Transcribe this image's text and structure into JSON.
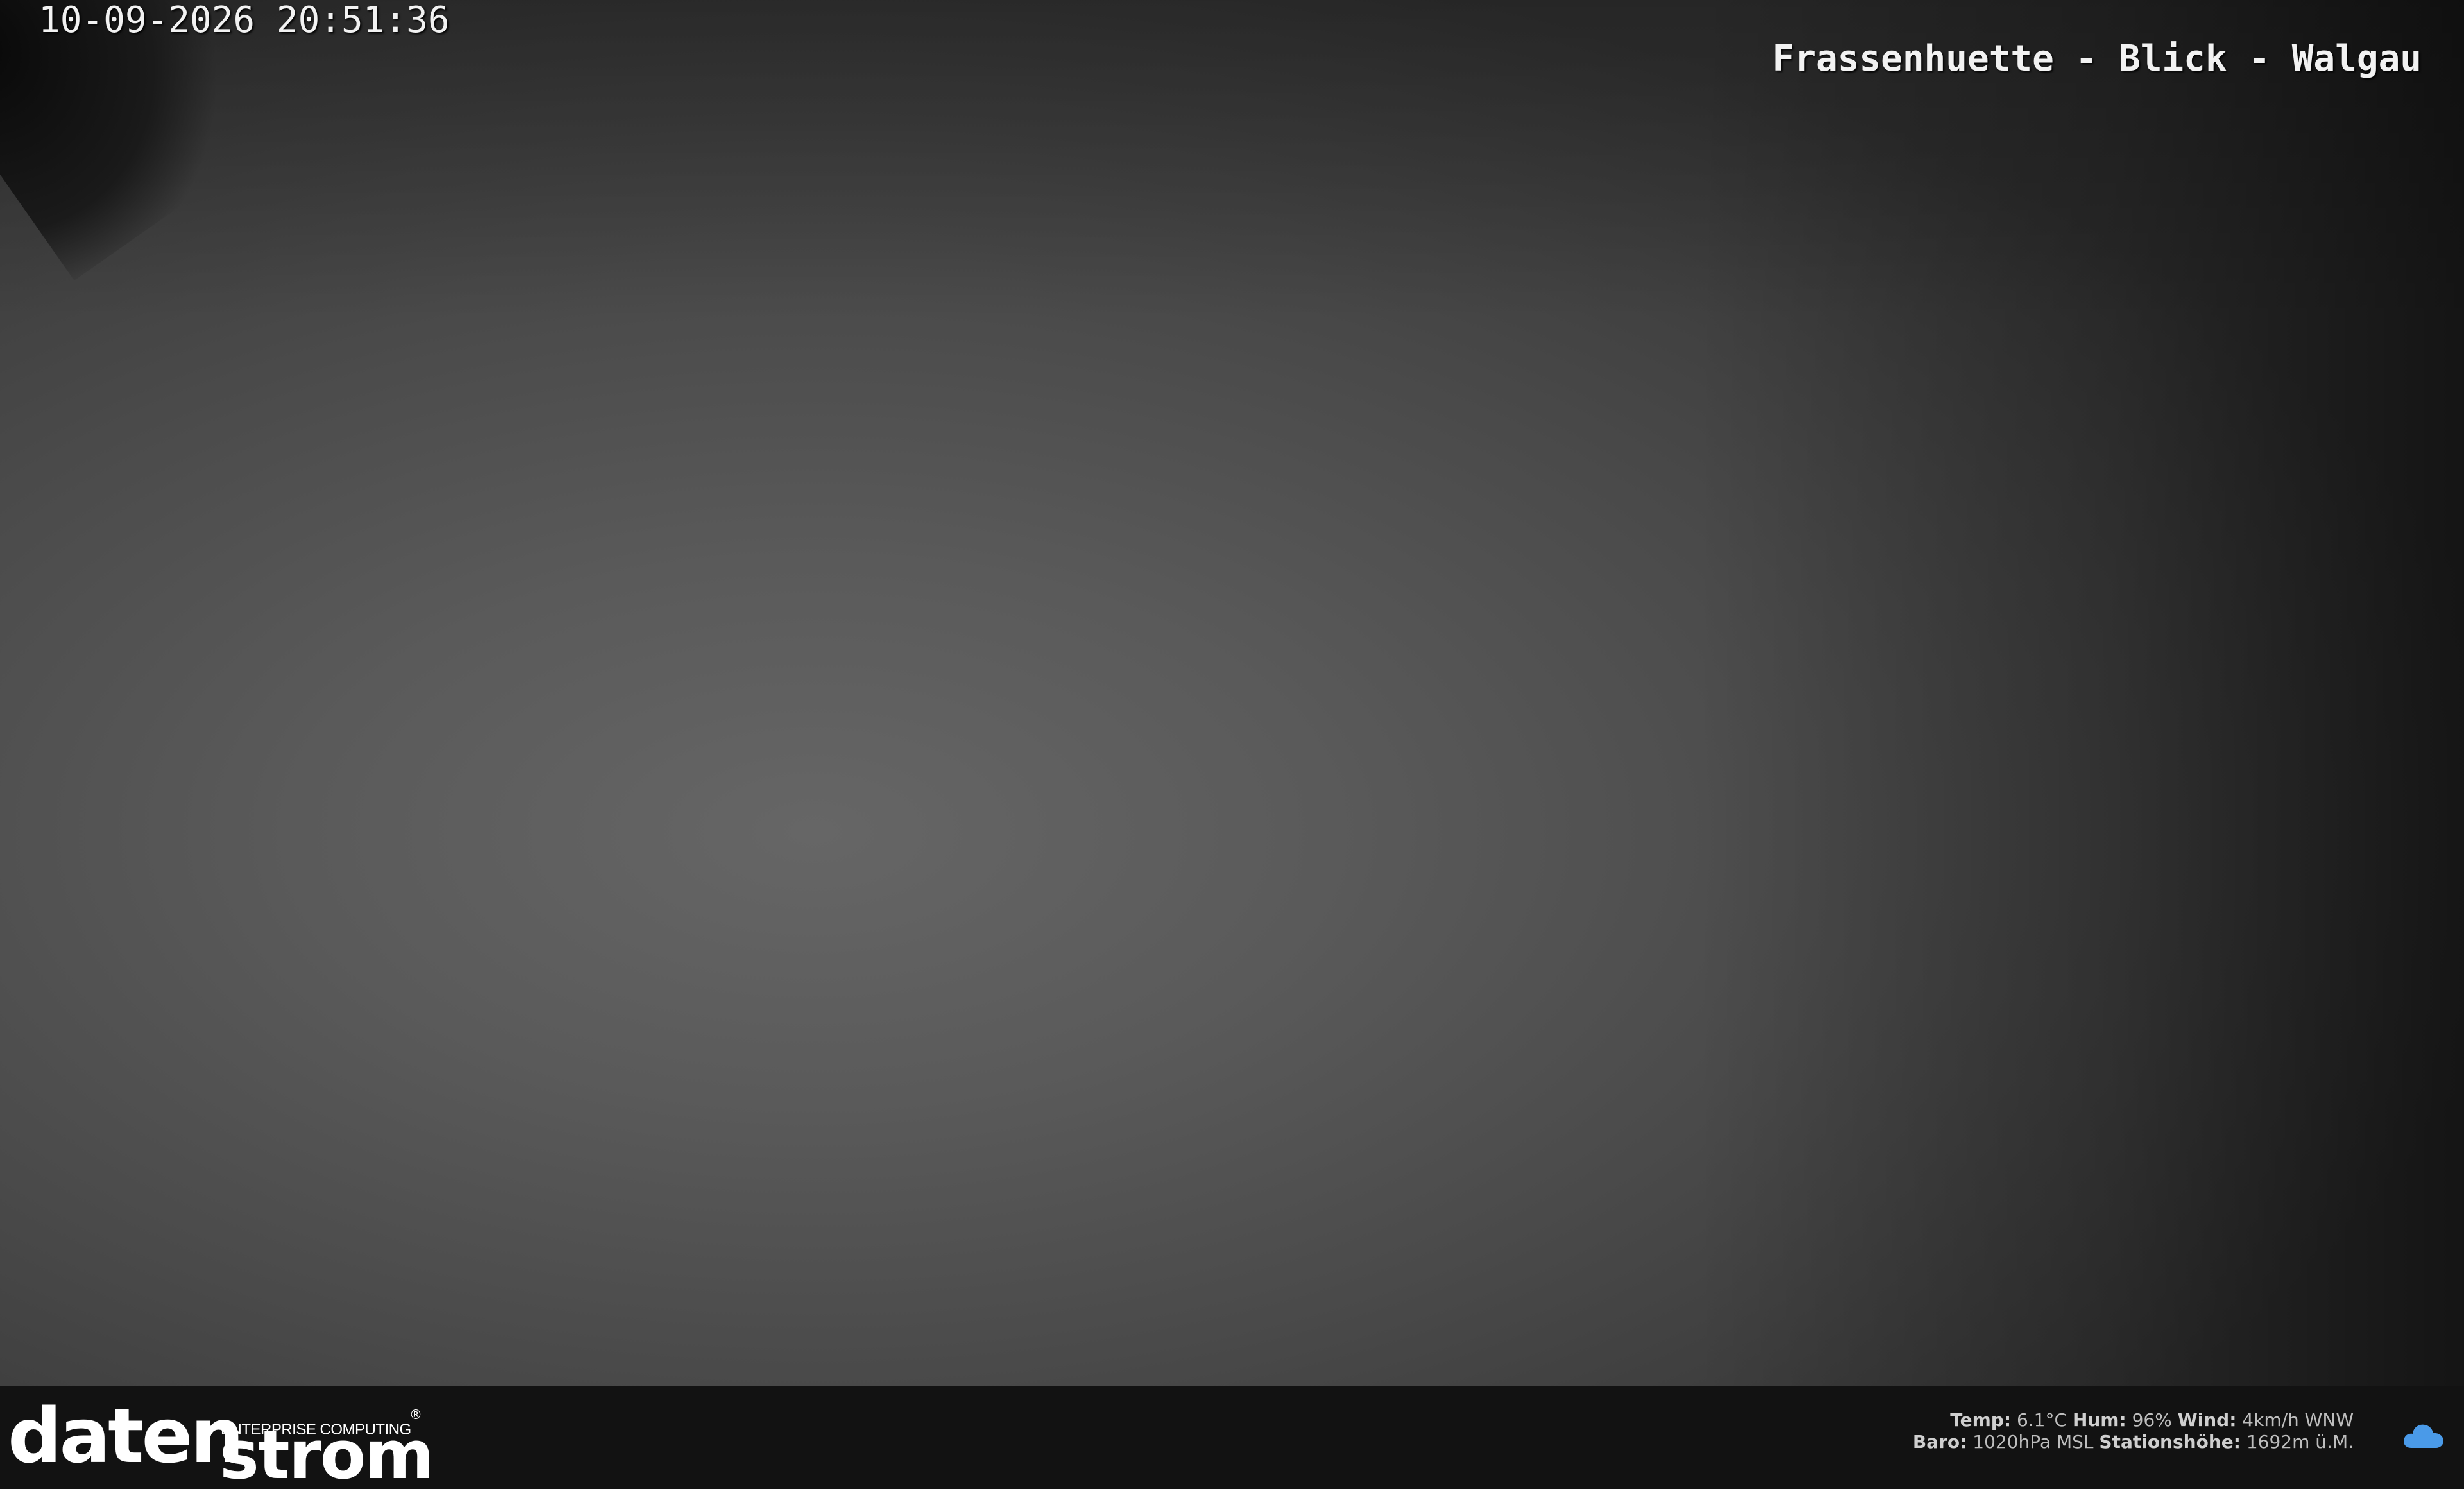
{
  "osd": {
    "timestamp": "10-09-2026 20:51:36",
    "title": "Frassenhuette - Blick - Walgau"
  },
  "footer": {
    "logo": {
      "main": "daten",
      "secondary": "strom",
      "tagline": "ENTERPRISE COMPUTING",
      "registered": "®"
    },
    "weather": {
      "temp_label": "Temp:",
      "temp_value": "6.1°C",
      "hum_label": "Hum:",
      "hum_value": "96%",
      "wind_label": "Wind:",
      "wind_value": "4km/h WNW",
      "baro_label": "Baro:",
      "baro_value": "1020hPa MSL",
      "station_label": "Stationshöhe:",
      "station_value": "1692m ü.M.",
      "icon": "cloud-icon",
      "icon_color": "#4a9ae8"
    }
  }
}
